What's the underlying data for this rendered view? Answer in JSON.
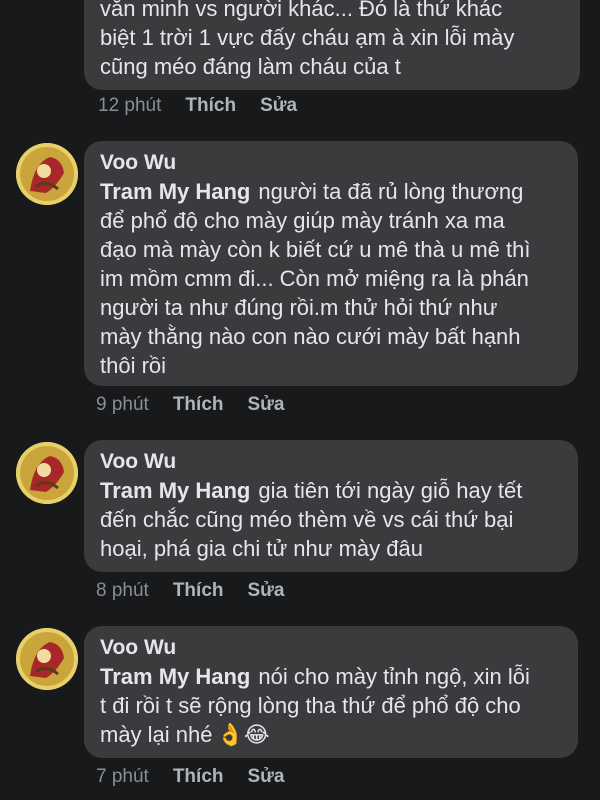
{
  "comments": [
    {
      "author": "",
      "mention": "",
      "text": "văn minh vs người khác... Đó là thứ khác\nbiệt 1 trời 1 vực đấy cháu ạm à xin lỗi mày\ncũng méo đáng làm cháu của t",
      "time": "12 phút",
      "like": "Thích",
      "edit": "Sửa"
    },
    {
      "author": "Voo Wu",
      "mention": "Tram My Hang",
      "text": "người ta đã rủ lòng thương\nđể phổ độ cho mày giúp mày tránh xa ma\nđạo mà mày còn k biết cứ u mê thà u mê thì\nim mồm cmm đi... Còn mở miệng ra là phán\nngười ta như đúng rồi.m thử hỏi thứ như\nmày thằng nào con nào cưới mày bất hạnh\nthôi rồi",
      "time": "9 phút",
      "like": "Thích",
      "edit": "Sửa"
    },
    {
      "author": "Voo Wu",
      "mention": "Tram My Hang",
      "text": "gia tiên tới ngày giỗ hay tết\nđến chắc cũng méo thèm về vs cái thứ bại\nhoại, phá gia chi tử như mày đâu",
      "time": "8 phút",
      "like": "Thích",
      "edit": "Sửa"
    },
    {
      "author": "Voo Wu",
      "mention": "Tram My Hang",
      "text": "nói cho mày tỉnh ngộ, xin lỗi\nt đi rồi t sẽ rộng lòng tha thứ để phổ độ cho\nmày lại nhé",
      "emoji": "👌😂",
      "time": "7 phút",
      "like": "Thích",
      "edit": "Sửa"
    }
  ]
}
